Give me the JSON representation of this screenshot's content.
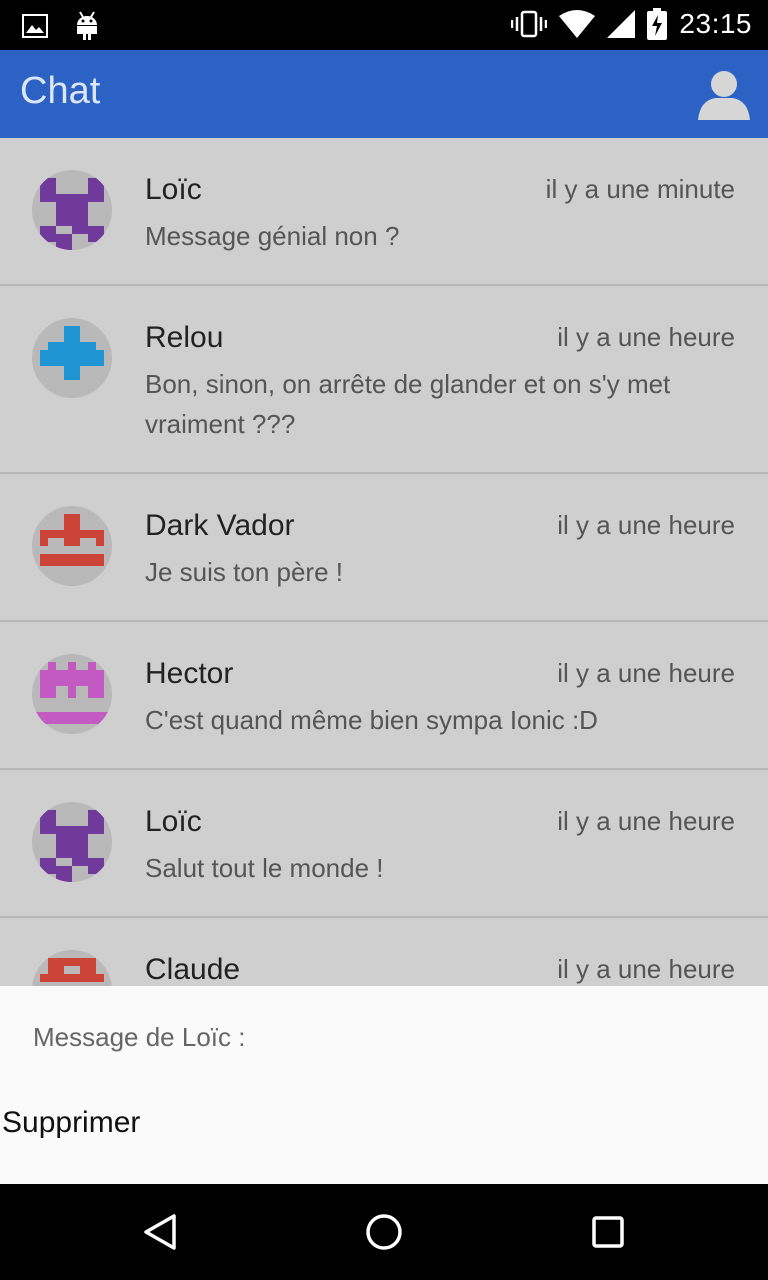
{
  "status_bar": {
    "time": "23:15"
  },
  "toolbar": {
    "title": "Chat"
  },
  "messages": [
    {
      "name": "Loïc",
      "time": "il y a une minute",
      "text": "Message génial non ?",
      "avatar_color": "#6f3a99"
    },
    {
      "name": "Relou",
      "time": "il y a une heure",
      "text": "Bon, sinon, on arrête de glander et on s'y met vraiment ???",
      "avatar_color": "#1f94d2"
    },
    {
      "name": "Dark Vador",
      "time": "il y a une heure",
      "text": "Je suis ton père !",
      "avatar_color": "#cc4437"
    },
    {
      "name": "Hector",
      "time": "il y a une heure",
      "text": "C'est quand même bien sympa Ionic :D",
      "avatar_color": "#c25ac2"
    },
    {
      "name": "Loïc",
      "time": "il y a une heure",
      "text": "Salut tout le monde !",
      "avatar_color": "#6f3a99"
    },
    {
      "name": "Claude",
      "time": "il y a une heure",
      "text": "",
      "avatar_color": "#cc4437"
    }
  ],
  "action_sheet": {
    "title": "Message de Loïc :",
    "delete_label": "Supprimer"
  },
  "colors": {
    "toolbar": "#2b62c3",
    "list_bg": "#cfcfcf",
    "sheet_bg": "#fafafa"
  }
}
